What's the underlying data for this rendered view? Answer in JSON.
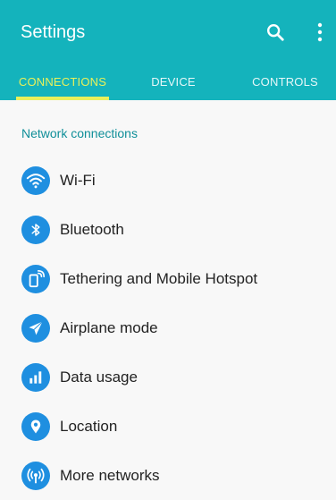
{
  "header": {
    "title": "Settings",
    "search_icon": "search-icon",
    "more_icon": "more-vert-icon",
    "background_color": "#14b3bc"
  },
  "tabs": [
    {
      "label": "CONNECTIONS",
      "active": true
    },
    {
      "label": "DEVICE",
      "active": false
    },
    {
      "label": "CONTROLS",
      "active": false
    }
  ],
  "accent_color": "#e9f05a",
  "section": {
    "title": "Network connections"
  },
  "items": [
    {
      "label": "Wi-Fi",
      "icon": "wifi-icon"
    },
    {
      "label": "Bluetooth",
      "icon": "bluetooth-icon"
    },
    {
      "label": "Tethering and Mobile Hotspot",
      "icon": "hotspot-icon"
    },
    {
      "label": "Airplane mode",
      "icon": "airplane-icon"
    },
    {
      "label": "Data usage",
      "icon": "data-usage-icon"
    },
    {
      "label": "Location",
      "icon": "location-icon"
    },
    {
      "label": "More networks",
      "icon": "more-networks-icon"
    }
  ],
  "icon_color": "#1f8fe0"
}
